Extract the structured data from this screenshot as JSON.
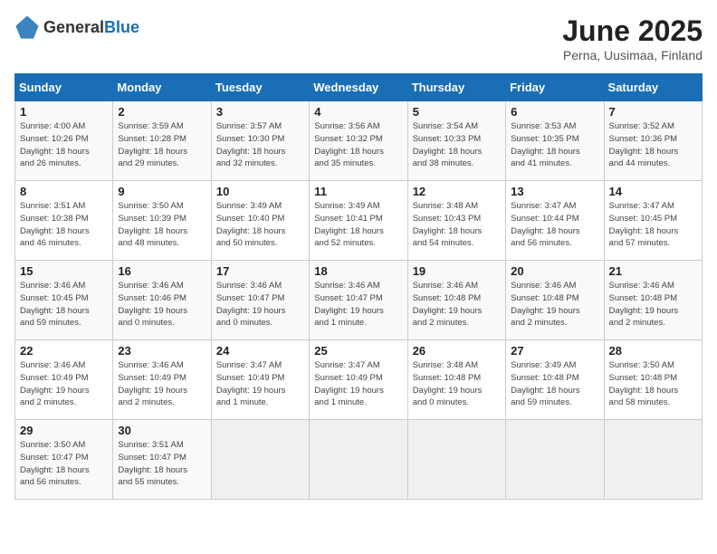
{
  "logo": {
    "general": "General",
    "blue": "Blue"
  },
  "header": {
    "month": "June 2025",
    "location": "Perna, Uusimaa, Finland"
  },
  "weekdays": [
    "Sunday",
    "Monday",
    "Tuesday",
    "Wednesday",
    "Thursday",
    "Friday",
    "Saturday"
  ],
  "weeks": [
    [
      {
        "day": "1",
        "info": "Sunrise: 4:00 AM\nSunset: 10:26 PM\nDaylight: 18 hours\nand 26 minutes."
      },
      {
        "day": "2",
        "info": "Sunrise: 3:59 AM\nSunset: 10:28 PM\nDaylight: 18 hours\nand 29 minutes."
      },
      {
        "day": "3",
        "info": "Sunrise: 3:57 AM\nSunset: 10:30 PM\nDaylight: 18 hours\nand 32 minutes."
      },
      {
        "day": "4",
        "info": "Sunrise: 3:56 AM\nSunset: 10:32 PM\nDaylight: 18 hours\nand 35 minutes."
      },
      {
        "day": "5",
        "info": "Sunrise: 3:54 AM\nSunset: 10:33 PM\nDaylight: 18 hours\nand 38 minutes."
      },
      {
        "day": "6",
        "info": "Sunrise: 3:53 AM\nSunset: 10:35 PM\nDaylight: 18 hours\nand 41 minutes."
      },
      {
        "day": "7",
        "info": "Sunrise: 3:52 AM\nSunset: 10:36 PM\nDaylight: 18 hours\nand 44 minutes."
      }
    ],
    [
      {
        "day": "8",
        "info": "Sunrise: 3:51 AM\nSunset: 10:38 PM\nDaylight: 18 hours\nand 46 minutes."
      },
      {
        "day": "9",
        "info": "Sunrise: 3:50 AM\nSunset: 10:39 PM\nDaylight: 18 hours\nand 48 minutes."
      },
      {
        "day": "10",
        "info": "Sunrise: 3:49 AM\nSunset: 10:40 PM\nDaylight: 18 hours\nand 50 minutes."
      },
      {
        "day": "11",
        "info": "Sunrise: 3:49 AM\nSunset: 10:41 PM\nDaylight: 18 hours\nand 52 minutes."
      },
      {
        "day": "12",
        "info": "Sunrise: 3:48 AM\nSunset: 10:43 PM\nDaylight: 18 hours\nand 54 minutes."
      },
      {
        "day": "13",
        "info": "Sunrise: 3:47 AM\nSunset: 10:44 PM\nDaylight: 18 hours\nand 56 minutes."
      },
      {
        "day": "14",
        "info": "Sunrise: 3:47 AM\nSunset: 10:45 PM\nDaylight: 18 hours\nand 57 minutes."
      }
    ],
    [
      {
        "day": "15",
        "info": "Sunrise: 3:46 AM\nSunset: 10:45 PM\nDaylight: 18 hours\nand 59 minutes."
      },
      {
        "day": "16",
        "info": "Sunrise: 3:46 AM\nSunset: 10:46 PM\nDaylight: 19 hours\nand 0 minutes."
      },
      {
        "day": "17",
        "info": "Sunrise: 3:46 AM\nSunset: 10:47 PM\nDaylight: 19 hours\nand 0 minutes."
      },
      {
        "day": "18",
        "info": "Sunrise: 3:46 AM\nSunset: 10:47 PM\nDaylight: 19 hours\nand 1 minute."
      },
      {
        "day": "19",
        "info": "Sunrise: 3:46 AM\nSunset: 10:48 PM\nDaylight: 19 hours\nand 2 minutes."
      },
      {
        "day": "20",
        "info": "Sunrise: 3:46 AM\nSunset: 10:48 PM\nDaylight: 19 hours\nand 2 minutes."
      },
      {
        "day": "21",
        "info": "Sunrise: 3:46 AM\nSunset: 10:48 PM\nDaylight: 19 hours\nand 2 minutes."
      }
    ],
    [
      {
        "day": "22",
        "info": "Sunrise: 3:46 AM\nSunset: 10:49 PM\nDaylight: 19 hours\nand 2 minutes."
      },
      {
        "day": "23",
        "info": "Sunrise: 3:46 AM\nSunset: 10:49 PM\nDaylight: 19 hours\nand 2 minutes."
      },
      {
        "day": "24",
        "info": "Sunrise: 3:47 AM\nSunset: 10:49 PM\nDaylight: 19 hours\nand 1 minute."
      },
      {
        "day": "25",
        "info": "Sunrise: 3:47 AM\nSunset: 10:49 PM\nDaylight: 19 hours\nand 1 minute."
      },
      {
        "day": "26",
        "info": "Sunrise: 3:48 AM\nSunset: 10:48 PM\nDaylight: 19 hours\nand 0 minutes."
      },
      {
        "day": "27",
        "info": "Sunrise: 3:49 AM\nSunset: 10:48 PM\nDaylight: 18 hours\nand 59 minutes."
      },
      {
        "day": "28",
        "info": "Sunrise: 3:50 AM\nSunset: 10:48 PM\nDaylight: 18 hours\nand 58 minutes."
      }
    ],
    [
      {
        "day": "29",
        "info": "Sunrise: 3:50 AM\nSunset: 10:47 PM\nDaylight: 18 hours\nand 56 minutes."
      },
      {
        "day": "30",
        "info": "Sunrise: 3:51 AM\nSunset: 10:47 PM\nDaylight: 18 hours\nand 55 minutes."
      },
      {
        "day": "",
        "info": ""
      },
      {
        "day": "",
        "info": ""
      },
      {
        "day": "",
        "info": ""
      },
      {
        "day": "",
        "info": ""
      },
      {
        "day": "",
        "info": ""
      }
    ]
  ]
}
